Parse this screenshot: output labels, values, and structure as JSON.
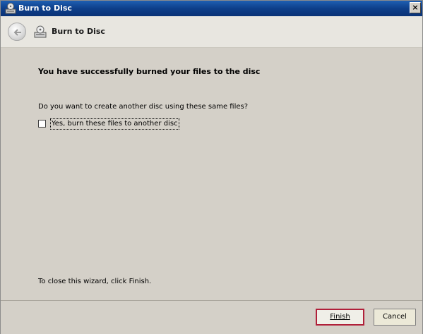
{
  "window": {
    "title": "Burn to Disc",
    "close_glyph": "×"
  },
  "nav": {
    "title": "Burn to Disc",
    "icons": {
      "back": "back-arrow-icon",
      "wizard": "disc-burner-icon"
    }
  },
  "content": {
    "heading": "You have successfully burned your files to the disc",
    "question": "Do you want to create another disc using these same files?",
    "checkbox": {
      "label": "Yes, burn these files to another disc",
      "checked": false
    },
    "close_hint": "To close this wizard, click Finish."
  },
  "buttons": {
    "finish": "Finish",
    "cancel": "Cancel"
  },
  "colors": {
    "titlebar": "#0e3f8a",
    "panel": "#d4d0c8",
    "default_button_border": "#b0203a"
  }
}
